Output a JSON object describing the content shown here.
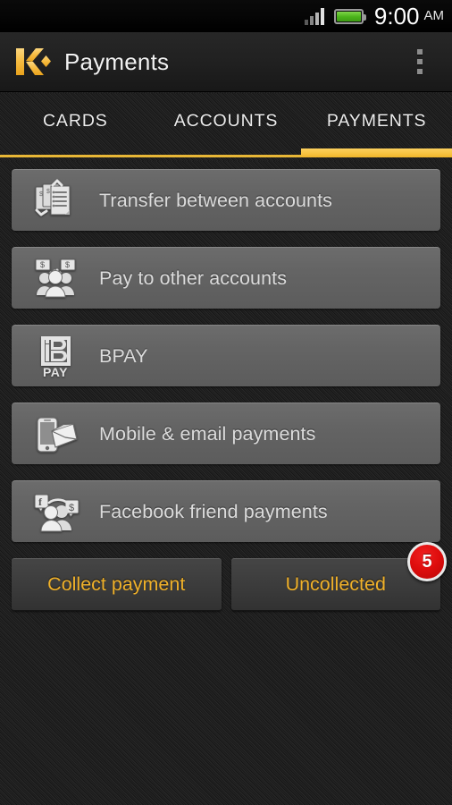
{
  "status_bar": {
    "signal_icon": "signal-bars-icon",
    "signal_bars": 4,
    "battery_icon": "battery-full-icon",
    "battery_level": "full",
    "time": "9:00",
    "meridiem": "AM"
  },
  "action_bar": {
    "logo_icon": "kaching-k-logo",
    "title": "Payments",
    "overflow_icon": "overflow-menu-icon"
  },
  "tabs": {
    "items": [
      {
        "label": "CARDS",
        "active": false
      },
      {
        "label": "ACCOUNTS",
        "active": false
      },
      {
        "label": "PAYMENTS",
        "active": true
      }
    ],
    "active_index": 2
  },
  "payment_options": [
    {
      "label": "Transfer between accounts",
      "icon": "transfer-documents-icon"
    },
    {
      "label": "Pay to other accounts",
      "icon": "people-with-cash-icon"
    },
    {
      "label": "BPAY",
      "icon": "bpay-logo-icon"
    },
    {
      "label": "Mobile & email payments",
      "icon": "phone-envelope-icon"
    },
    {
      "label": "Facebook friend payments",
      "icon": "facebook-friends-icon"
    }
  ],
  "bottom_actions": {
    "collect_label": "Collect payment",
    "uncollected_label": "Uncollected",
    "uncollected_badge_count": "5"
  },
  "colors": {
    "accent_gold": "#f0b12a",
    "tab_indicator": "#f7c23f",
    "badge_red": "#de0d0d",
    "battery_green": "#49b21a",
    "row_gray": "#646464",
    "background_dark": "#212121"
  }
}
